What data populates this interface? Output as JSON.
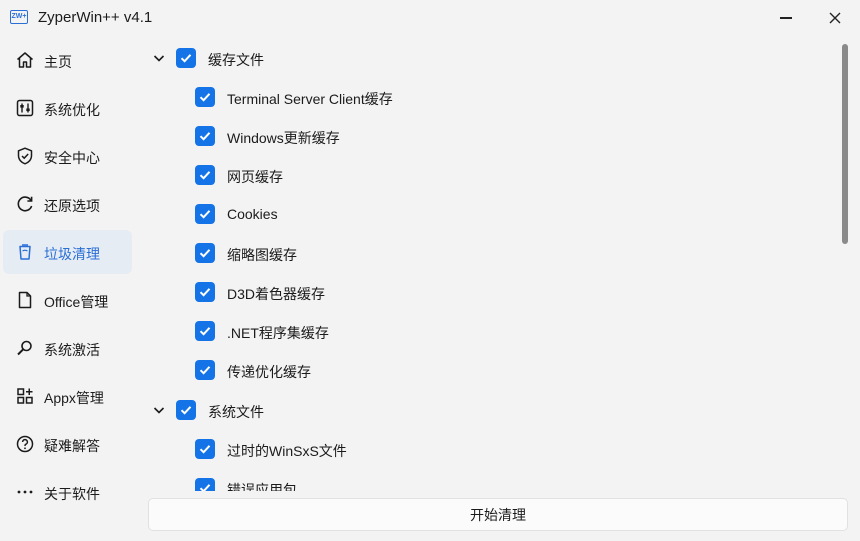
{
  "window": {
    "title": "ZyperWin++ v4.1",
    "icon_text": "ZW+"
  },
  "sidebar": {
    "items": [
      {
        "label": "主页",
        "icon": "home-icon"
      },
      {
        "label": "系统优化",
        "icon": "sliders-icon"
      },
      {
        "label": "安全中心",
        "icon": "shield-icon"
      },
      {
        "label": "还原选项",
        "icon": "refresh-icon"
      },
      {
        "label": "垃圾清理",
        "icon": "trash-icon",
        "active": true
      },
      {
        "label": "Office管理",
        "icon": "office-icon"
      },
      {
        "label": "系统激活",
        "icon": "key-icon"
      },
      {
        "label": "Appx管理",
        "icon": "apps-icon"
      },
      {
        "label": "疑难解答",
        "icon": "help-icon"
      },
      {
        "label": "关于软件",
        "icon": "more-icon"
      }
    ]
  },
  "tree": {
    "groups": [
      {
        "label": "缓存文件",
        "checked": true,
        "expanded": true,
        "items": [
          {
            "label": "Terminal Server Client缓存",
            "checked": true
          },
          {
            "label": "Windows更新缓存",
            "checked": true
          },
          {
            "label": "网页缓存",
            "checked": true
          },
          {
            "label": "Cookies",
            "checked": true
          },
          {
            "label": "缩略图缓存",
            "checked": true
          },
          {
            "label": "D3D着色器缓存",
            "checked": true
          },
          {
            "label": ".NET程序集缓存",
            "checked": true
          },
          {
            "label": "传递优化缓存",
            "checked": true
          }
        ]
      },
      {
        "label": "系统文件",
        "checked": true,
        "expanded": true,
        "items": [
          {
            "label": "过时的WinSxS文件",
            "checked": true
          },
          {
            "label": "错误应用包",
            "checked": true
          }
        ]
      }
    ]
  },
  "action": {
    "label": "开始清理"
  },
  "colors": {
    "accent": "#1473e6",
    "active_bg": "#e6ecf4",
    "background": "#f3f3f3"
  }
}
